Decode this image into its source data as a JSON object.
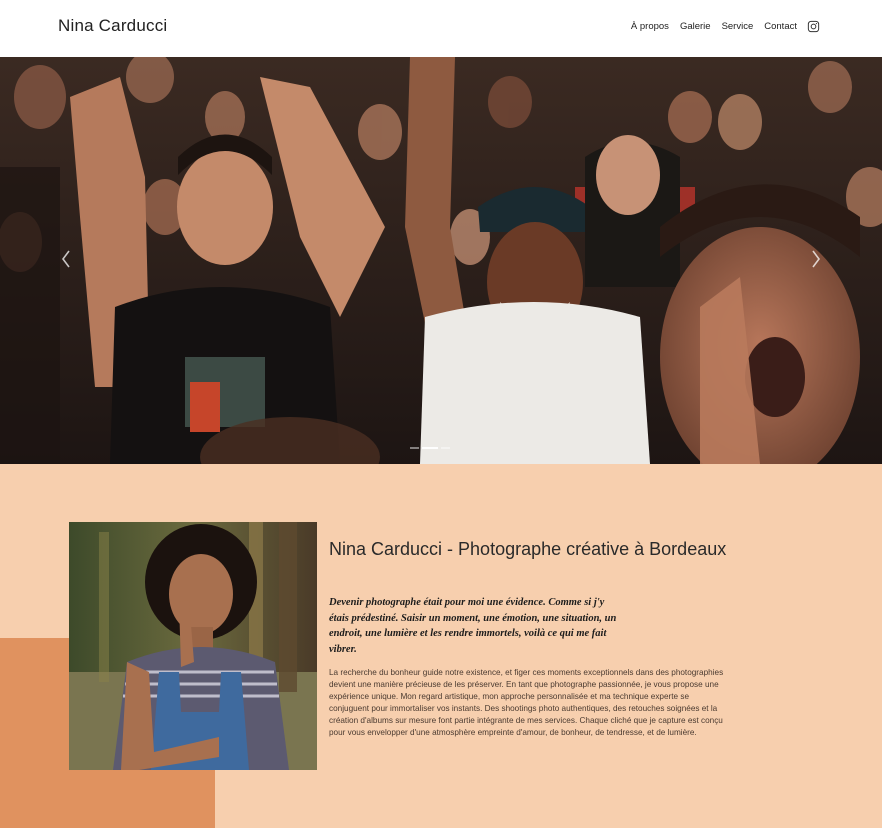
{
  "header": {
    "brand": "Nina Carducci",
    "nav": [
      {
        "label": "À propos"
      },
      {
        "label": "Galerie"
      },
      {
        "label": "Service"
      },
      {
        "label": "Contact"
      }
    ],
    "social_icon": "instagram-icon"
  },
  "hero": {
    "image": "concert-crowd-photo",
    "arrows": [
      "chevron-left-icon",
      "chevron-right-icon"
    ],
    "slides_count": 3,
    "active_slide": 2
  },
  "about": {
    "title": "Nina Carducci - Photographe créative à Bordeaux",
    "quote": "Devenir photographe était pour moi une évidence. Comme si j'y étais prédestiné. Saisir un moment, une émotion, une situation, un endroit, une lumière et les rendre immortels, voilà ce qui me fait vibrer.",
    "body": "La recherche du bonheur guide notre existence, et figer ces moments exceptionnels dans des photographies devient une manière précieuse de les préserver. En tant que photographe passionnée, je vous propose une expérience unique. Mon regard artistique, mon approche personnalisée et ma technique experte se conjuguent pour immortaliser vos instants. Des shootings photo authentiques, des retouches soignées et la création d'albums sur mesure font partie intégrante de mes services. Chaque cliché que je capture est conçu pour vous envelopper d'une atmosphère empreinte d'amour, de bonheur, de tendresse, et de lumière.",
    "portrait": "portrait-photo"
  },
  "colors": {
    "section_bg": "#f7cfae",
    "accent": "#e0925f"
  }
}
